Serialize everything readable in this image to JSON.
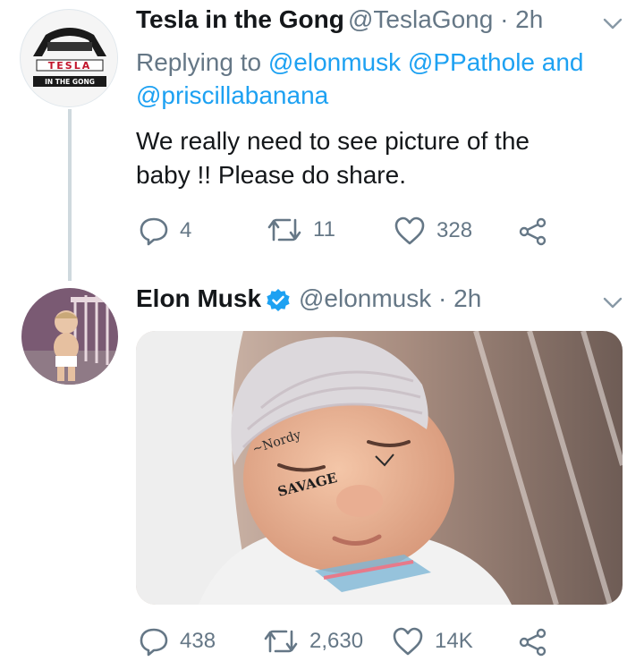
{
  "tweets": [
    {
      "display_name": "Tesla in the Gong",
      "handle_time": "@TeslaGong · 2h",
      "avatar_logo": {
        "brand": "TESLA",
        "tagline": "IN THE GONG"
      },
      "reply_prefix": "Replying to",
      "reply_mention_1": "@elonmusk",
      "reply_mention_2": "@PPathole",
      "reply_conj": "and",
      "reply_mention_3": "@priscillabanana",
      "text_line_1": "We really need to see picture of the",
      "text_line_2": "baby !! Please do share.",
      "replies": "4",
      "retweets": "11",
      "likes": "328"
    },
    {
      "display_name": "Elon Musk",
      "verified": true,
      "handle_time": "@elonmusk · 2h",
      "media": {
        "face_text": "SAVAGE"
      },
      "replies": "438",
      "retweets": "2,630",
      "likes": "14K"
    }
  ],
  "colors": {
    "link": "#1da1f2",
    "muted": "#657786",
    "thread": "#cfd9de"
  },
  "icons": [
    "chevron-down-icon",
    "reply-icon",
    "retweet-icon",
    "like-icon",
    "share-icon",
    "verified-icon"
  ]
}
